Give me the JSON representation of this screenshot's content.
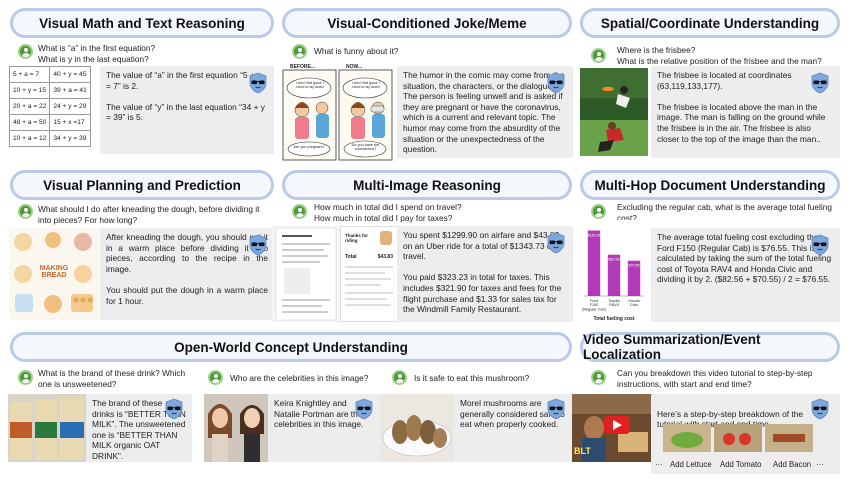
{
  "sections": {
    "math": {
      "title": "Visual Math and Text Reasoning",
      "question": "What is “a” in the first equation?\nWhat is y in the last equation?",
      "equations": [
        [
          "5 + a = 7",
          "40 + y = 45"
        ],
        [
          "10 + y = 15",
          "39 + a = 41"
        ],
        [
          "20 + a = 22",
          "24 + y = 29"
        ],
        [
          "48 + a = 50",
          "15 + x =17"
        ],
        [
          "10 + a = 12",
          "34 + y = 39"
        ]
      ],
      "answer": "The value of “a” in the first equation “5 + a = 7” is 2.\n\nThe value of “y” in the last equation “34 + y = 39” is 5."
    },
    "joke": {
      "title": "Visual-Conditioned Joke/Meme",
      "question": "What is funny about it?",
      "comic": {
        "panel1_caption": "BEFORE...",
        "panel2_caption": "NOW...",
        "bubble1": "I don't feel good, I need to lay down",
        "bubble2": "I don't feel good, I need to lay down",
        "reply1": "Are you pregnant?",
        "reply2": "Do you have the coronavirus?"
      },
      "answer": "The humor in the comic may come from the situation, the characters, or the dialogue. The person is feeling unwell and is asked if they are pregnant or have the coronavirus, which is a current and relevant topic. The humor may come from the absurdity of the situation or the unexpectedness of the question."
    },
    "spatial": {
      "title": "Spatial/Coordinate Understanding",
      "question": "Where is the frisbee?\nWhat is the relative position of the frisbee and the man?",
      "answer": "The frisbee is located at coordinates (63,119,133,177).\n\nThe frisbee is located above the man in the image. The man is falling on the ground while the frisbee is in the air. The frisbee is also closer to the top of the image than the man.."
    },
    "planning": {
      "title": "Visual Planning and Prediction",
      "question": "What should I do after kneading the dough, before dividing it into pieces? For how long?",
      "recipe_text": "MAKING BREAD",
      "answer": "After kneading the dough, you should put it in a warm place before dividing it into pieces, according to the recipe in the image.\n\nYou should put the dough in a warm place for 1 hour."
    },
    "multi_image": {
      "title": "Multi-Image Reasoning",
      "question": "How much in total did I spend on travel?\nHow much in total did I pay for taxes?",
      "receipt2_title": "Thanks for riding",
      "total_label": "Total",
      "total_value": "$43.83",
      "answer": "You spent $1299.90 on airfare and $43.83 on an Uber ride for a total of $1343.73 on travel.\n\nYou paid $323.23 in total for taxes. This includes $321.90 for taxes and fees for the flight purchase and $1.33 for sales tax for the Windmill Family Restaurant."
    },
    "doc": {
      "title": "Multi-Hop Document Understanding",
      "question": "Excluding the regular cab, what is the average total fueling cost?",
      "answer": "The average total fueling cost excluding the Ford F150 (Regular Cab) is $76.55. This is calculated by taking the sum of the total fueling cost of Toyota RAV4 and Honda Civic and dividing it by 2. ($82.56 + $70.55) / 2 = $76.55."
    },
    "open_world": {
      "title": "Open-World Concept Understanding",
      "q1": "What is the brand of these drink? Which one is unsweetened?",
      "a1": "The brand of these drinks is “BETTER THAN MILK”. The unsweetened one is “BETTER THAN MILK organic OAT DRINK”.",
      "q2": "Who are the celebrities in this image?",
      "a2": "Keira Knightley and Natalie Portman are the celebrities in this image.",
      "q3": "Is it safe to eat this mushroom?",
      "a3": "Morel mushrooms are generally considered safe to eat when properly cooked."
    },
    "video": {
      "title": "Video Summarization/Event Localization",
      "question": "Can you breakdown this video tutorial to step-by-step instructions, with start and end time?",
      "answer": "Here’s a step-by-step breakdown of the tutorial with start and end time.",
      "steps": [
        "Add Lettuce",
        "Add Tomato",
        "Add Bacon"
      ],
      "ellipsis": "···",
      "thumb_text": "BLT"
    }
  },
  "chart_data": {
    "type": "bar",
    "categories": [
      "Ford F150 (Regular Cab)",
      "Toyota RAV4",
      "Honda Civic"
    ],
    "values": [
      130.96,
      82.56,
      70.55
    ],
    "value_labels": [
      "$130.96",
      "$82.56",
      "$70.55"
    ],
    "category_lines": [
      [
        "Ford",
        "F150",
        "(Regular Cab)"
      ],
      [
        "Toyota",
        "RAV4"
      ],
      [
        "Honda",
        "Civic"
      ]
    ],
    "title": "",
    "xlabel": "Total fueling cost",
    "ylabel": "",
    "ylim": [
      0,
      140
    ],
    "bar_color": "#b23ab8"
  },
  "colors": {
    "title_border": "#b9cbe8",
    "title_fill": "#f4f7fc",
    "avatar": "#4f9a3c",
    "answer_bg": "#ededed",
    "bot_shield": "#7da7dd"
  },
  "icons": {
    "user": "user-avatar-icon",
    "assistant": "robot-sunglasses-icon"
  }
}
